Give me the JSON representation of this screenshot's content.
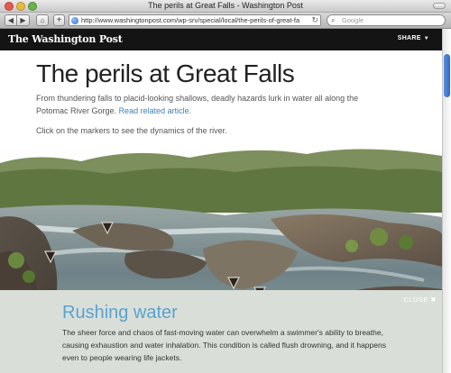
{
  "window": {
    "title": "The perils at Great Falls - Washington Post"
  },
  "toolbar": {
    "back_icon": "◀",
    "forward_icon": "▶",
    "home_icon": "⌂",
    "add_icon": "+",
    "url": "http://www.washingtonpost.com/wp-srv/special/local/the-perils-of-great-fa",
    "reload_icon": "↻",
    "search_placeholder": "Google",
    "search_icon": "⌕"
  },
  "header": {
    "logo": "The Washington Post",
    "share_label": "SHARE",
    "share_caret": "▼"
  },
  "article": {
    "headline": "The perils at Great Falls",
    "dek_text": "From thundering falls to placid-looking shallows, deadly hazards lurk in water all along the Potomac River Gorge.",
    "dek_link": "Read related article.",
    "instructions": "Click on the markers to see the dynamics of the river."
  },
  "info_panel": {
    "close_label": "CLOSE ✖",
    "title": "Rushing water",
    "body": "The sheer force and chaos of fast-moving water can overwhelm a swimmer's ability to breathe, causing exhaustion and water inhalation. This condition is called flush drowning, and it happens even to people wearing life jackets."
  },
  "colors": {
    "header_bg": "#141414",
    "link": "#3d7fb3",
    "info_title": "#5aa2cf",
    "info_bg": "#d9dfd8"
  }
}
